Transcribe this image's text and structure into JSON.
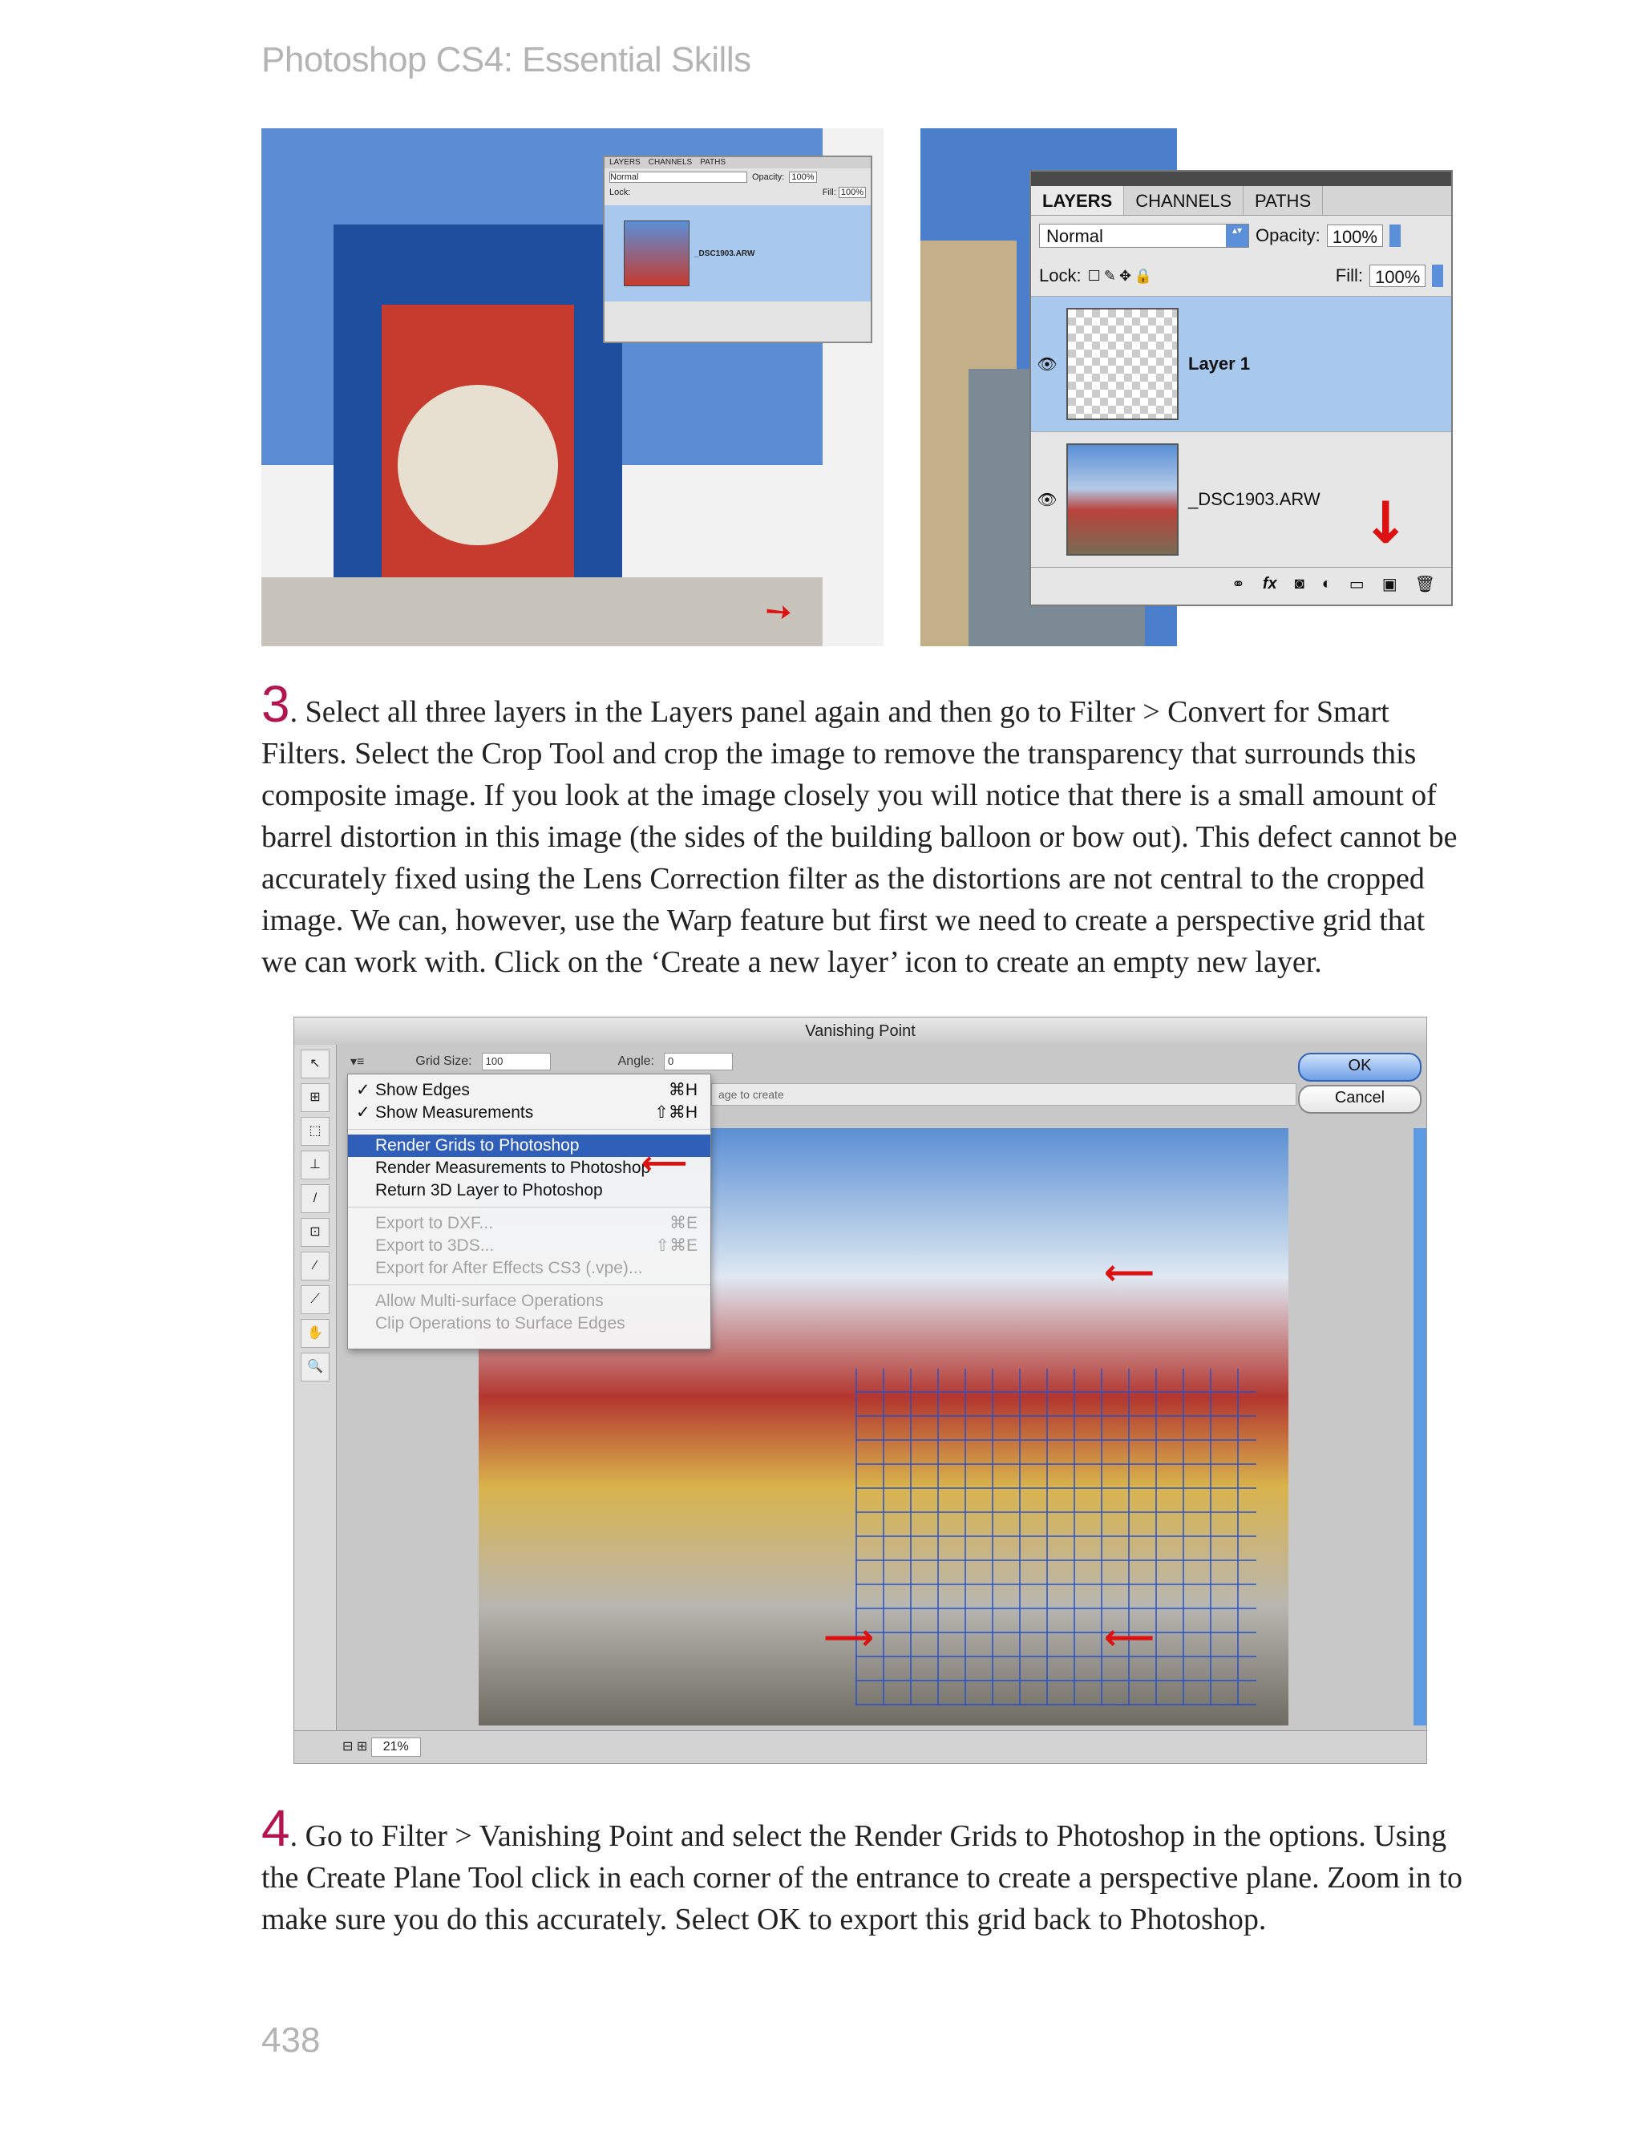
{
  "running_head": "Photoshop CS4: Essential Skills",
  "folio": "438",
  "figure_left": {
    "panel": {
      "tabs": [
        "LAYERS",
        "CHANNELS",
        "PATHS"
      ],
      "blend_mode": "Normal",
      "opacity_label": "Opacity:",
      "opacity": "100%",
      "lock_label": "Lock:",
      "fill_label": "Fill:",
      "fill": "100%",
      "layer_name": "_DSC1903.ARW"
    }
  },
  "figure_right": {
    "panel": {
      "tabs": [
        "LAYERS",
        "CHANNELS",
        "PATHS"
      ],
      "blend_mode": "Normal",
      "opacity_label": "Opacity:",
      "opacity": "100%",
      "lock_label": "Lock:",
      "fill_label": "Fill:",
      "fill": "100%",
      "layers": [
        {
          "name": "Layer 1"
        },
        {
          "name": "_DSC1903.ARW"
        }
      ],
      "footer_icons": [
        "link-icon",
        "fx-icon",
        "mask-icon",
        "adjustment-icon",
        "group-icon",
        "new-layer-icon",
        "trash-icon"
      ]
    }
  },
  "step3": {
    "num": "3",
    "text": ". Select all three layers in the Layers panel again and then go to Filter > Convert for Smart Filters. Select the Crop Tool and crop the image to remove the transparency that surrounds this composite image. If you look at the image closely you will notice that there is a small amount of barrel distortion in this image (the sides of the building balloon or bow out). This defect cannot be accurately fixed using the Lens Correction filter as the distortions are not central to the cropped image. We can, however, use the Warp feature but first we need to create a perspective grid that we can work with. Click on the ‘Create a new layer’ icon to create an empty new layer."
  },
  "vanishing_point": {
    "title": "Vanishing Point",
    "grid_size_label": "Grid Size:",
    "grid_size": "100",
    "angle_label": "Angle:",
    "angle": "0",
    "ok": "OK",
    "cancel": "Cancel",
    "hint": "age to create",
    "zoom": "21%",
    "menu": [
      {
        "label": "Show Edges",
        "shortcut": "⌘H",
        "checked": "✓"
      },
      {
        "label": "Show Measurements",
        "shortcut": "⇧⌘H",
        "checked": "✓"
      },
      {
        "label": "Render Grids to Photoshop",
        "shortcut": ""
      },
      {
        "label": "Render Measurements to Photoshop",
        "shortcut": ""
      },
      {
        "label": "Return 3D Layer to Photoshop",
        "shortcut": ""
      },
      {
        "label": "Export to DXF...",
        "shortcut": "⌘E"
      },
      {
        "label": "Export to 3DS...",
        "shortcut": "⇧⌘E"
      },
      {
        "label": "Export for After Effects CS3 (.vpe)...",
        "shortcut": ""
      },
      {
        "label": "Allow Multi-surface Operations",
        "shortcut": ""
      },
      {
        "label": "Clip Operations to Surface Edges",
        "shortcut": ""
      }
    ]
  },
  "step4": {
    "num": "4",
    "text": ". Go to Filter > Vanishing Point and select the Render Grids to Photoshop in the options. Using the Create Plane Tool click in each corner of the entrance to create a perspective plane. Zoom in to make sure you do this accurately. Select OK to export this grid back to Photoshop."
  }
}
